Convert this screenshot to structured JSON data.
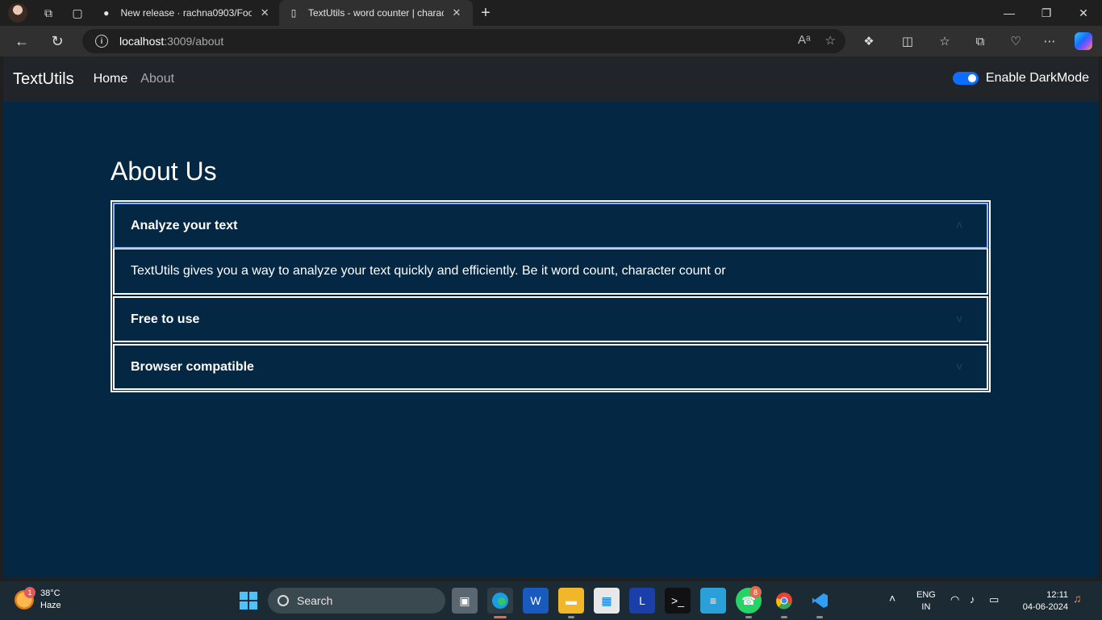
{
  "browser": {
    "tabs": [
      {
        "title": "New release · rachna0903/Food-",
        "icon": "github-icon"
      },
      {
        "title": "TextUtils - word counter | charact",
        "icon": "page-icon"
      }
    ],
    "url_host": "localhost",
    "url_path": ":3009/about"
  },
  "navbar": {
    "brand": "TextUtils",
    "links": [
      "Home",
      "About"
    ],
    "darkmode_label": "Enable DarkMode",
    "darkmode_on": true
  },
  "page": {
    "title": "About Us",
    "accordion": [
      {
        "header": "Analyze your text",
        "body": "TextUtils gives you a way to analyze your text quickly and efficiently. Be it word count, character count or",
        "open": true
      },
      {
        "header": "Free to use",
        "open": false
      },
      {
        "header": "Browser compatible",
        "open": false
      }
    ]
  },
  "colors": {
    "page_bg": "#042743",
    "navbar_bg": "#212529",
    "switch_accent": "#0d6efd"
  },
  "taskbar": {
    "weather_temp": "38°C",
    "weather_desc": "Haze",
    "weather_badge": "1",
    "search_label": "Search",
    "whatsapp_badge": "8",
    "lang_top": "ENG",
    "lang_bottom": "IN",
    "time": "12:11",
    "date": "04-06-2024"
  }
}
